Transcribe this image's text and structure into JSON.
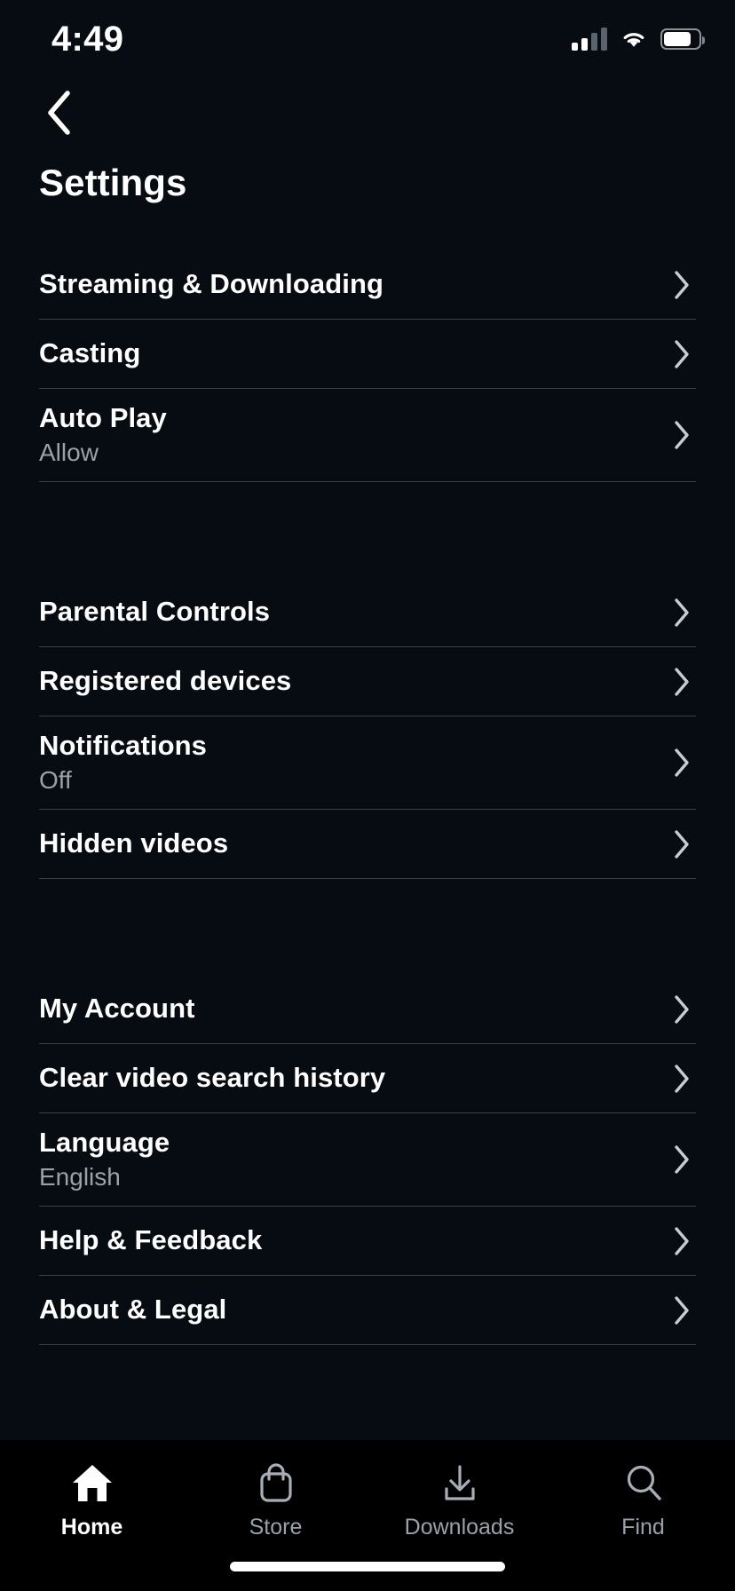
{
  "status_bar": {
    "time": "4:49",
    "signal_icon": "cellular-signal-icon",
    "signal_bars_filled": 2,
    "signal_bars_total": 4,
    "wifi_icon": "wifi-icon",
    "battery_icon": "battery-icon",
    "battery_level_percent": 80
  },
  "nav": {
    "back_icon": "chevron-left-icon"
  },
  "header": {
    "title": "Settings"
  },
  "colors": {
    "background": "#070b12",
    "tabbar_background": "#000000",
    "text_primary": "#ffffff",
    "text_secondary": "#9aa1ab",
    "divider": "#3a4049"
  },
  "groups": [
    {
      "items": [
        {
          "label": "Streaming & Downloading",
          "value": null,
          "chevron": "chevron-right-icon"
        },
        {
          "label": "Casting",
          "value": null,
          "chevron": "chevron-right-icon"
        },
        {
          "label": "Auto Play",
          "value": "Allow",
          "chevron": "chevron-right-icon"
        }
      ]
    },
    {
      "items": [
        {
          "label": "Parental Controls",
          "value": null,
          "chevron": "chevron-right-icon"
        },
        {
          "label": "Registered devices",
          "value": null,
          "chevron": "chevron-right-icon"
        },
        {
          "label": "Notifications",
          "value": "Off",
          "chevron": "chevron-right-icon"
        },
        {
          "label": "Hidden videos",
          "value": null,
          "chevron": "chevron-right-icon"
        }
      ]
    },
    {
      "items": [
        {
          "label": "My Account",
          "value": null,
          "chevron": "chevron-right-icon"
        },
        {
          "label": "Clear video search history",
          "value": null,
          "chevron": "chevron-right-icon"
        },
        {
          "label": "Language",
          "value": "English",
          "chevron": "chevron-right-icon"
        },
        {
          "label": "Help & Feedback",
          "value": null,
          "chevron": "chevron-right-icon"
        },
        {
          "label": "About & Legal",
          "value": null,
          "chevron": "chevron-right-icon"
        }
      ]
    }
  ],
  "tabbar": {
    "tabs": [
      {
        "label": "Home",
        "icon": "home-icon",
        "active": true
      },
      {
        "label": "Store",
        "icon": "shopping-bag-icon",
        "active": false
      },
      {
        "label": "Downloads",
        "icon": "download-arrow-icon",
        "active": false
      },
      {
        "label": "Find",
        "icon": "magnifier-icon",
        "active": false
      }
    ]
  },
  "home_indicator": "home-indicator-bar"
}
